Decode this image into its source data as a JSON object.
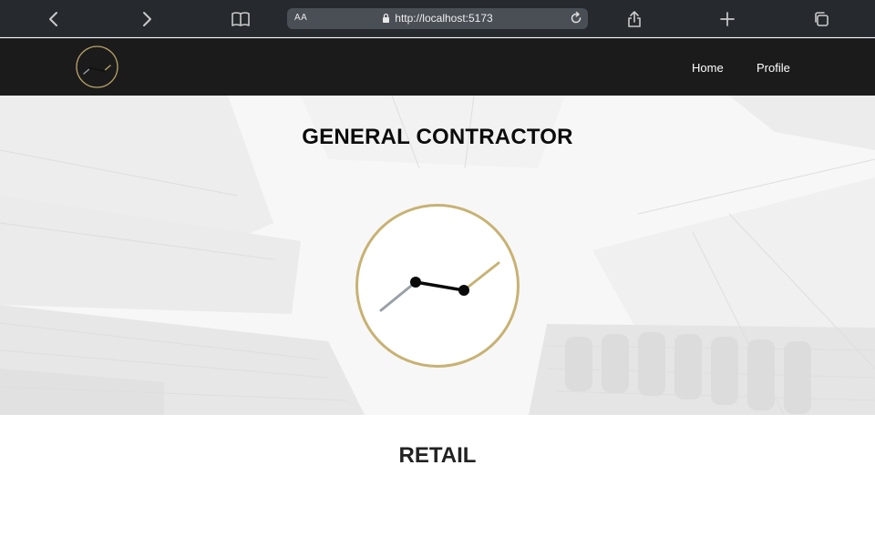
{
  "browser": {
    "text_size_label": "AA",
    "url": "http://localhost:5173"
  },
  "nav": {
    "links": [
      "Home",
      "Profile"
    ]
  },
  "hero": {
    "title": "GENERAL CONTRACTOR"
  },
  "sections": {
    "retail_title": "RETAIL"
  },
  "colors": {
    "chrome_bg": "#262a2f",
    "nav_bg": "#1b1b1b",
    "gold_accent": "#c8b273",
    "gray_line": "#9aa0a8"
  }
}
